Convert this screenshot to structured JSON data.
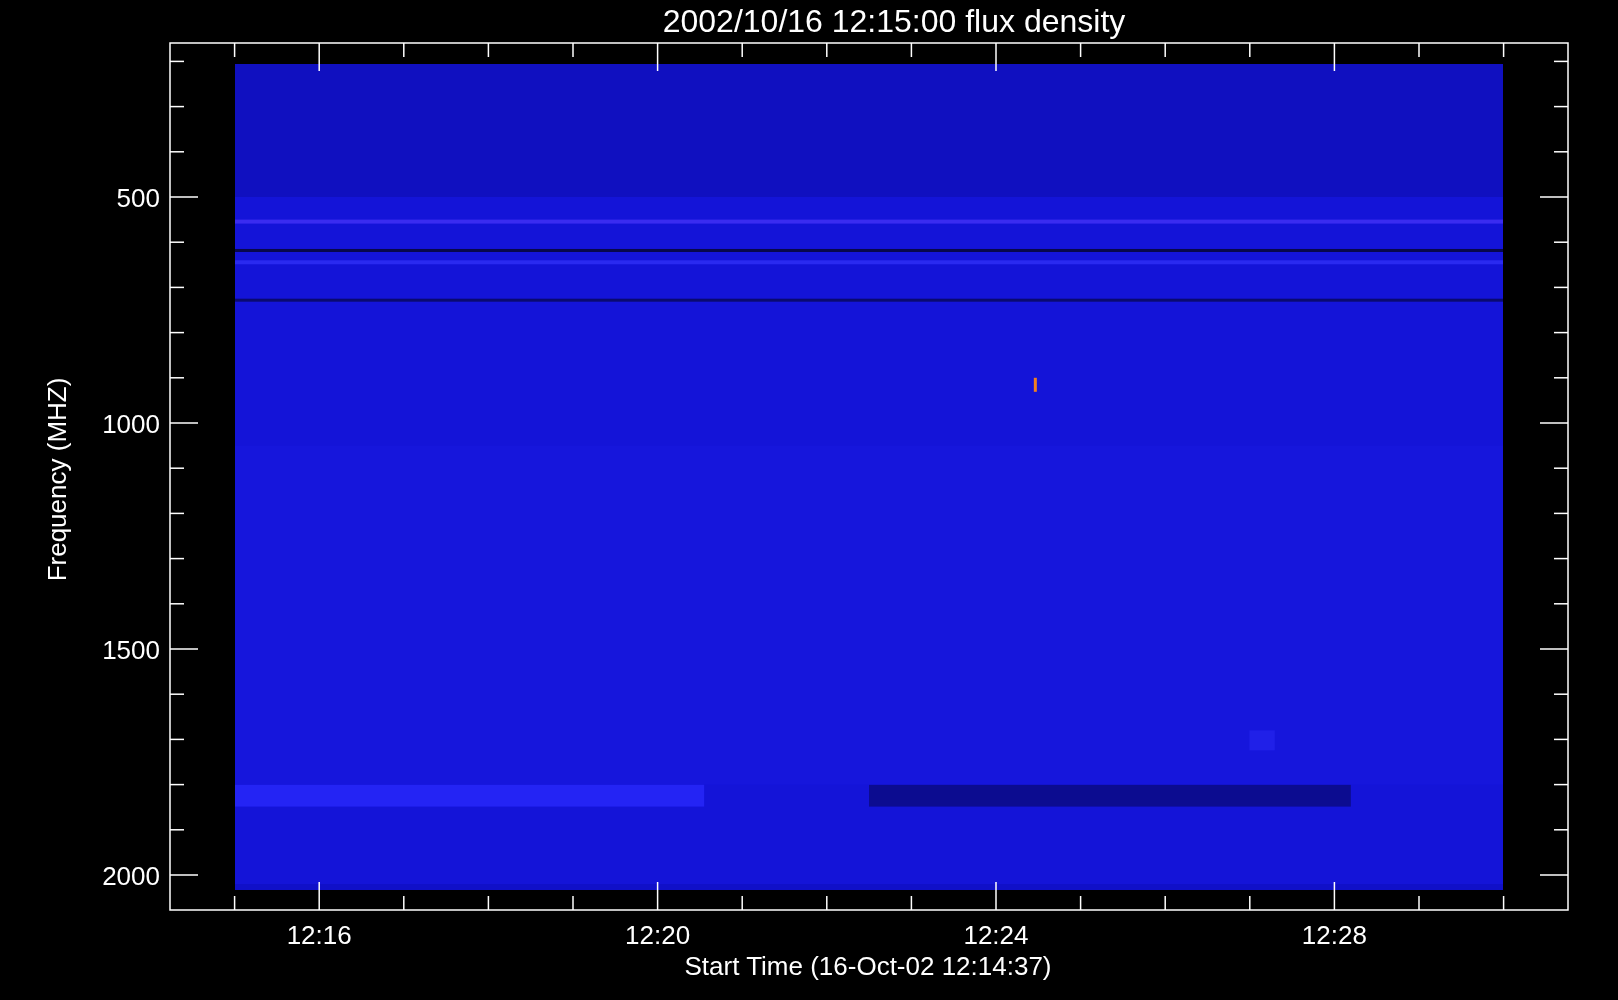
{
  "title": "2002/10/16 12:15:00 flux density",
  "y_axis": {
    "label": "Frequency (MHZ)",
    "ticks": [
      "500",
      "1000",
      "1500",
      "2000"
    ]
  },
  "x_axis": {
    "label": "Start Time (16-Oct-02 12:14:37)",
    "ticks": [
      "12:16",
      "12:20",
      "12:24",
      "12:28"
    ]
  }
}
